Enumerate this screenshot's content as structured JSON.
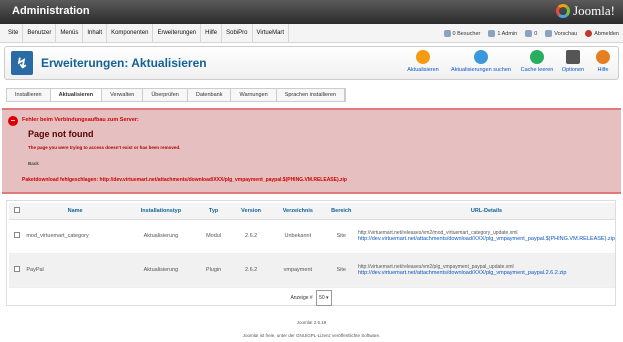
{
  "header": {
    "title": "Administration",
    "logo_text": "Joomla!"
  },
  "menu": [
    "Site",
    "Benutzer",
    "Menüs",
    "Inhalt",
    "Komponenten",
    "Erweiterungen",
    "Hilfe",
    "SobiPro",
    "VirtueMart"
  ],
  "status": {
    "visitors": "0 Besucher",
    "admin": "1 Admin",
    "messages": "0",
    "preview": "Vorschau",
    "logout": "Abmelden"
  },
  "toolbar": {
    "page_title": "Erweiterungen: Aktualisieren",
    "buttons": [
      "Aktualisieren",
      "Aktualisierungen suchen",
      "Cache leeren",
      "Optionen",
      "Hilfe"
    ]
  },
  "tabs": [
    "Installieren",
    "Aktualisieren",
    "Verwalten",
    "Überprüfen",
    "Datenbank",
    "Warnungen",
    "Sprachen installieren"
  ],
  "active_tab": "Aktualisieren",
  "error": {
    "heading": "Fehler beim Verbindungsaufbau zum Server:",
    "title": "Page not found",
    "message": "The page you were trying to access doesn't exist or has been removed.",
    "back": "Back",
    "failed": "Paketdownload fehlgeschlagen: http://dev.virtuemart.net/attachments/download/XXX/plg_vmpayment_paypal.$(PHING.VM.RELEASE).zip"
  },
  "table": {
    "headers": [
      "Name",
      "Installationstyp",
      "Typ",
      "Version",
      "Verzeichnis",
      "Bereich",
      "URL-Details"
    ],
    "rows": [
      {
        "name": "mod_virtuemart_category",
        "install_type": "Aktualisierung",
        "type": "Modul",
        "version": "2.6.2",
        "folder": "Unbekannt",
        "client": "Site",
        "url1": "http://virtuemart.net/releases/vm2/mod_virtuemart_category_update.xml",
        "url2": "http://dev.virtuemart.net/attachments/download/XXX/plg_vmpayment_paypal.$(PHING.VM.RELEASE).zip"
      },
      {
        "name": "PayPal",
        "install_type": "Aktualisierung",
        "type": "Plugin",
        "version": "2.6.2",
        "folder": "vmpayment",
        "client": "Site",
        "url1": "http://virtuemart.net/releases/vm2/plg_vmpayment_paypal_update.xml",
        "url2": "http://dev.virtuemart.net/attachments/download/XXX/plg_vmpayment_paypal.2.6.2.zip"
      }
    ]
  },
  "pager": {
    "label": "Anzeige #",
    "value": "50"
  },
  "footer": {
    "version": "Joomla! 2.5.19",
    "license": "Joomla! ist freie, unter der GNU/GPL-Lizenz veröffentlichte Software."
  }
}
